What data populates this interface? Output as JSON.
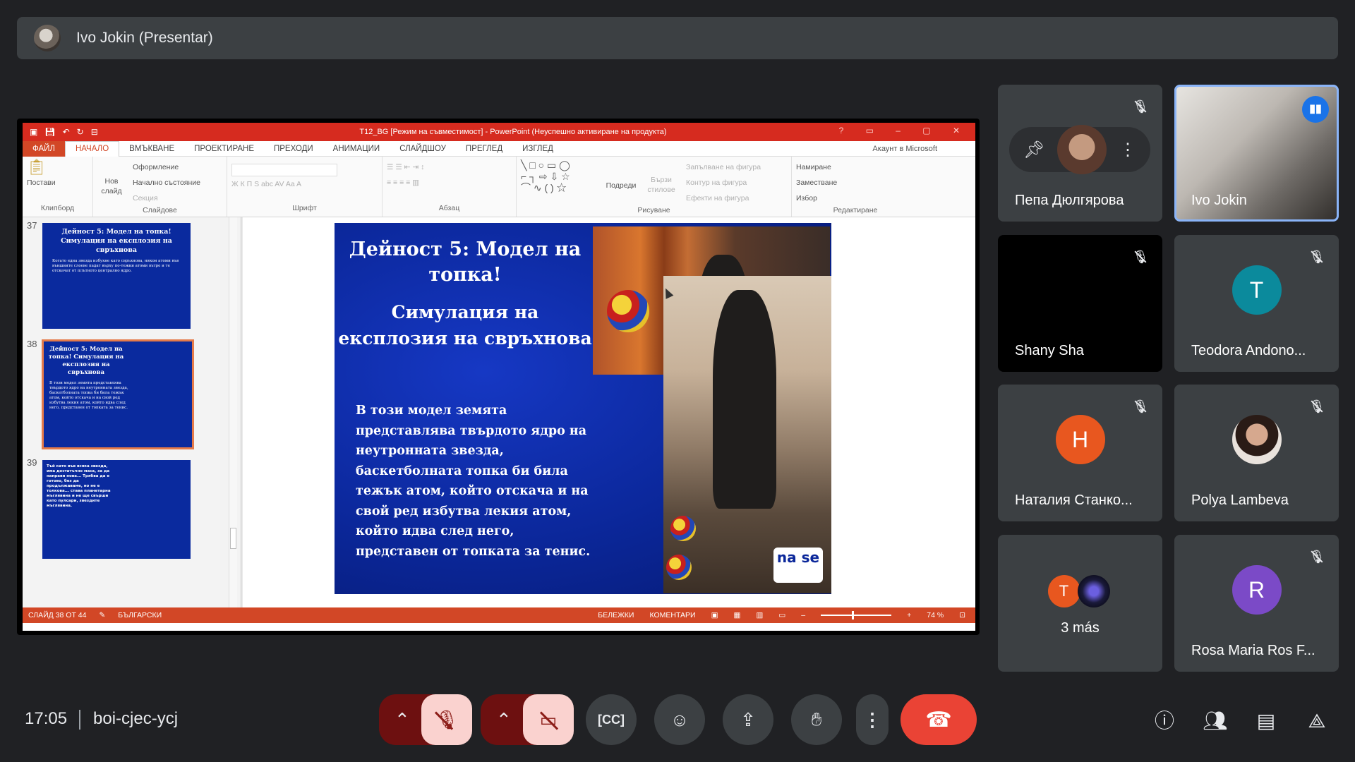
{
  "presenter_banner": {
    "name": "Ivo Jokin (Presentar)"
  },
  "powerpoint": {
    "window_title": "T12_BG [Режим на съвместимост] - PowerPoint (Неуспешно активиране на продукта)",
    "tabs": [
      "ФАЙЛ",
      "НАЧАЛО",
      "ВМЪКВАНЕ",
      "ПРОЕКТИРАНЕ",
      "ПРЕХОДИ",
      "АНИМАЦИИ",
      "СЛАЙДШОУ",
      "ПРЕГЛЕД",
      "ИЗГЛЕД"
    ],
    "account": "Акаунт в Microsoft",
    "ribbon": {
      "clipboard": {
        "paste": "Постави",
        "label": "Клипборд"
      },
      "slides": {
        "new_slide": "Нов слайд",
        "layout": "Оформление",
        "reset": "Начално състояние",
        "section": "Секция",
        "label": "Слайдове"
      },
      "font": {
        "label": "Шрифт"
      },
      "paragraph": {
        "label": "Абзац"
      },
      "drawing": {
        "arrange": "Подреди",
        "quick_styles": "Бързи стилове",
        "fill": "Запълване на фигура",
        "outline": "Контур на фигура",
        "effects": "Ефекти на фигура",
        "label": "Рисуване"
      },
      "editing": {
        "find": "Намиране",
        "replace": "Заместване",
        "select": "Избор",
        "label": "Редактиране"
      }
    },
    "thumbnails": [
      {
        "num": "37",
        "title": "Дейност 5: Модел на топка! Симулация на експлозия на свръхнова",
        "body": "Когато една звезда избухне като свръхнова, някои атоми във външните слоеве падат върху по-тежки атоми вътре и те отскачат от плътното централно ядро."
      },
      {
        "num": "38",
        "title": "Дейност 5: Модел на топка! Симулация на експлозия на свръхнова",
        "body": "В този модел земята представлява твърдото ядро на неутронната звезда, баскетболната топка би била тежък атом, който отскача и на свой ред избутва лекия атом, който идва след него, представен от топката за тенис."
      },
      {
        "num": "39",
        "title": "Тъй като във всяка звезда, има достатъчно маса, за да направи нова... Трябва да е готово, без да продължаваме, но не е толкова... става планетарна мъглявина и не ще свърши като пулсари, звездите мъглявина.",
        "body": ""
      }
    ],
    "slide": {
      "title": "Дейност 5: Модел на топка!",
      "subtitle": "Симулация на експлозия на свръхнова",
      "text": "В този модел земята представлява твърдото ядро на неутронната звезда, баскетболната топка би била тежък атом, който отскача и на свой ред избутва лекия атом, който идва след него, представен от топката за тенис.",
      "logo": "na se"
    },
    "status": {
      "slide_count": "СЛАЙД 38 ОТ 44",
      "language": "БЪЛГАРСКИ",
      "notes": "БЕЛЕЖКИ",
      "comments": "КОМЕНТАРИ",
      "zoom": "74 %"
    }
  },
  "participants": [
    {
      "name": "Пепа Дюлгярова",
      "muted": true,
      "pinned_controls": true
    },
    {
      "name": "Ivo Jokin",
      "speaking": true
    },
    {
      "name": "Shany Sha",
      "muted": true
    },
    {
      "name": "Teodora Andono...",
      "initial": "T",
      "color": "#0b8a9c",
      "muted": true
    },
    {
      "name": "Наталия Станко...",
      "initial": "Н",
      "color": "#e8571f",
      "muted": true
    },
    {
      "name": "Polya Lambeva",
      "muted": true
    },
    {
      "name": "3 más",
      "initial": "T",
      "color": "#e8571f"
    },
    {
      "name": "Rosa Maria Ros F...",
      "initial": "R",
      "color": "#7b4ac7",
      "muted": true
    }
  ],
  "bottom_bar": {
    "time": "17:05",
    "meeting_code": "boi-cjec-ycj"
  },
  "colors": {
    "background": "#202124",
    "tile": "#3c4043",
    "end_call": "#ea4335",
    "active_outline": "#8ab4f8"
  }
}
